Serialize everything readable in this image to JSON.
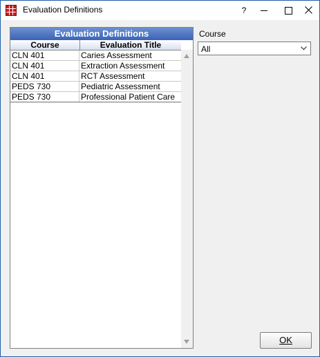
{
  "window": {
    "title": "Evaluation Definitions",
    "help_label": "?"
  },
  "grid": {
    "title": "Evaluation Definitions",
    "columns": [
      "Course",
      "Evaluation Title"
    ],
    "rows": [
      [
        "CLN 401",
        "Caries Assessment"
      ],
      [
        "CLN 401",
        "Extraction Assessment"
      ],
      [
        "CLN 401",
        "RCT Assessment"
      ],
      [
        "PEDS 730",
        "Pediatric Assessment"
      ],
      [
        "PEDS 730",
        "Professional Patient Care"
      ]
    ]
  },
  "filter": {
    "label": "Course",
    "selected": "All"
  },
  "buttons": {
    "ok_label": "OK"
  },
  "icons": {
    "app": "grid-app-icon",
    "minimize": "minimize-icon",
    "maximize": "maximize-icon",
    "close": "close-icon",
    "dropdown": "chevron-down-icon",
    "scroll_up": "arrow-up-icon",
    "scroll_down": "arrow-down-icon"
  },
  "colors": {
    "grid_title_bg": "#3a63b5",
    "window_border": "#1f5da8"
  }
}
